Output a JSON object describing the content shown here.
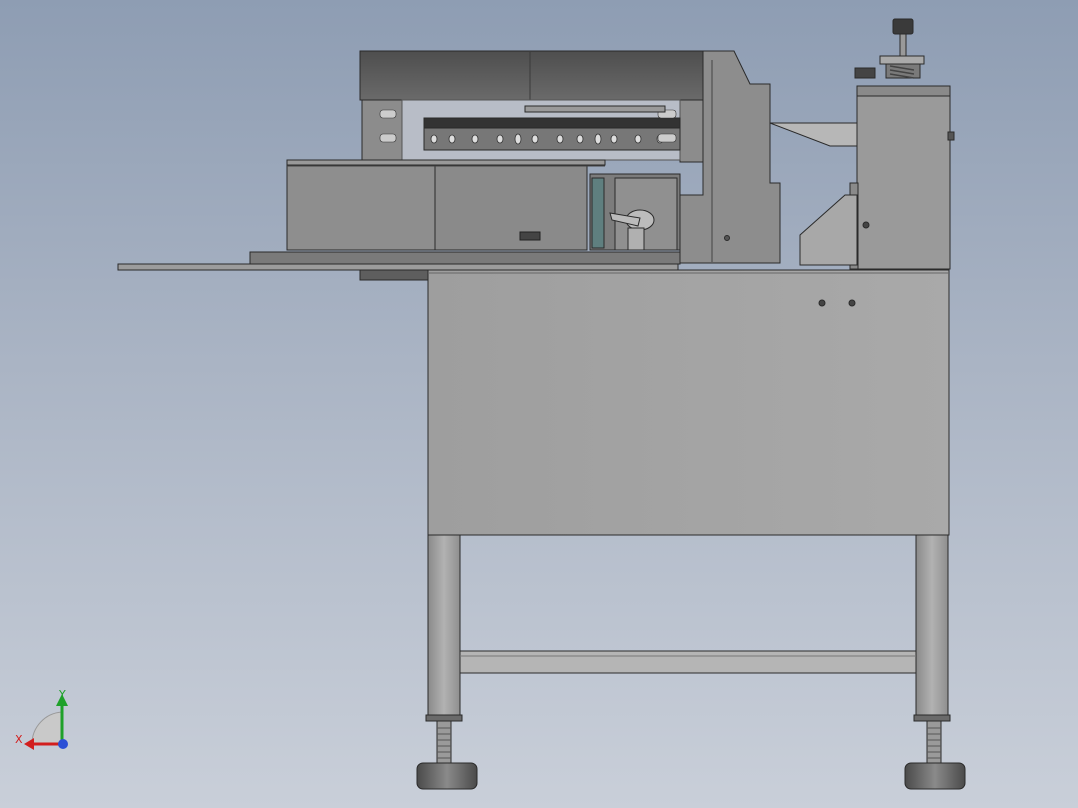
{
  "viewport": {
    "background_top": "#8e9db3",
    "background_bottom": "#c9cfd9"
  },
  "model": {
    "body_color": "#a3a3a3",
    "dark_color": "#5a5a5a",
    "edge_color": "#2a2a2a"
  },
  "triad": {
    "x_label": "X",
    "y_label": "Y",
    "x_color": "#d21e1e",
    "y_color": "#1fa12a"
  }
}
